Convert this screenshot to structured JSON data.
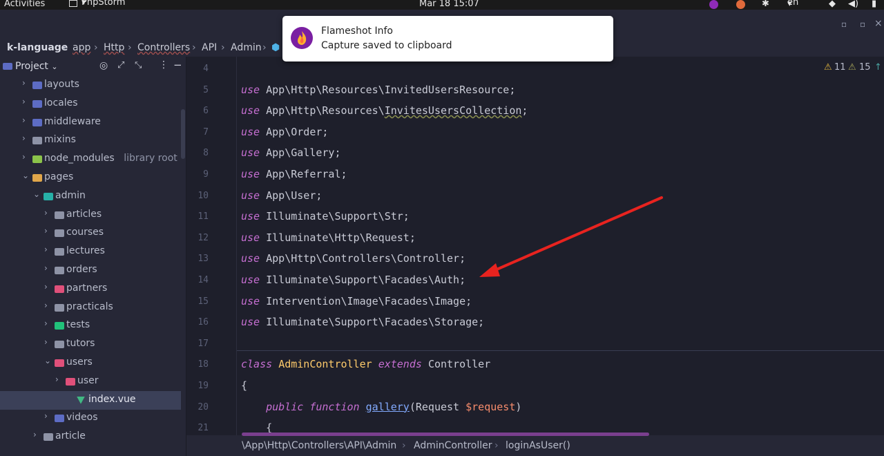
{
  "topbar": {
    "activities": "Activities",
    "app_name": "PhpStorm",
    "app_menu_icon": "triangle-down",
    "clock": "Mar 18  15:07",
    "lang": "en",
    "tray_icons": [
      "flameshot-icon",
      "chrome-icon",
      "slack-icon",
      "wifi-icon",
      "volume-icon",
      "battery-icon"
    ]
  },
  "window_controls": [
    "minimize",
    "maximize",
    "close"
  ],
  "breadcrumb": {
    "items": [
      "k-language",
      "app",
      "Http",
      "Controllers",
      "API",
      "Admin"
    ],
    "separator": "›"
  },
  "project_panel": {
    "title": "Project",
    "toolbar_icons": [
      "target-icon",
      "expand-icon",
      "collapse-icon",
      "more-icon",
      "hide-icon"
    ]
  },
  "tree": [
    {
      "label": "layouts",
      "extra": "",
      "depth": 0,
      "expanded": false,
      "icon_color": "#5d6cc4"
    },
    {
      "label": "locales",
      "extra": "",
      "depth": 0,
      "expanded": false,
      "icon_color": "#5d6cc4"
    },
    {
      "label": "middleware",
      "extra": "",
      "depth": 0,
      "expanded": false,
      "icon_color": "#5d6cc4"
    },
    {
      "label": "mixins",
      "extra": "",
      "depth": 0,
      "expanded": false,
      "icon_color": "#8e93a6"
    },
    {
      "label": "node_modules",
      "extra": "library root",
      "depth": 0,
      "expanded": false,
      "icon_color": "#8bc34a"
    },
    {
      "label": "pages",
      "extra": "",
      "depth": 0,
      "expanded": true,
      "icon_color": "#e0a64a"
    },
    {
      "label": "admin",
      "extra": "",
      "depth": 1,
      "expanded": true,
      "icon_color": "#27b1a8"
    },
    {
      "label": "articles",
      "extra": "",
      "depth": 2,
      "expanded": false,
      "icon_color": "#8e93a6"
    },
    {
      "label": "courses",
      "extra": "",
      "depth": 2,
      "expanded": false,
      "icon_color": "#8e93a6"
    },
    {
      "label": "lectures",
      "extra": "",
      "depth": 2,
      "expanded": false,
      "icon_color": "#8e93a6"
    },
    {
      "label": "orders",
      "extra": "",
      "depth": 2,
      "expanded": false,
      "icon_color": "#8e93a6"
    },
    {
      "label": "partners",
      "extra": "",
      "depth": 2,
      "expanded": false,
      "icon_color": "#e0507a"
    },
    {
      "label": "practicals",
      "extra": "",
      "depth": 2,
      "expanded": false,
      "icon_color": "#8e93a6"
    },
    {
      "label": "tests",
      "extra": "",
      "depth": 2,
      "expanded": false,
      "icon_color": "#21c17a"
    },
    {
      "label": "tutors",
      "extra": "",
      "depth": 2,
      "expanded": false,
      "icon_color": "#8e93a6"
    },
    {
      "label": "users",
      "extra": "",
      "depth": 2,
      "expanded": true,
      "icon_color": "#e0507a"
    },
    {
      "label": "user",
      "extra": "",
      "depth": 3,
      "expanded": false,
      "icon_color": "#e0507a"
    },
    {
      "label": "index.vue",
      "extra": "",
      "depth": 4,
      "expanded": null,
      "icon_color": "#41b883",
      "selected": true
    },
    {
      "label": "videos",
      "extra": "",
      "depth": 2,
      "expanded": false,
      "icon_color": "#5d6cc4"
    },
    {
      "label": "article",
      "extra": "",
      "depth": 1,
      "expanded": false,
      "icon_color": "#8e93a6"
    }
  ],
  "editor": {
    "inspections": {
      "warnings": "11",
      "weak_warnings": "15"
    },
    "line_numbers": [
      "4",
      "5",
      "6",
      "7",
      "8",
      "9",
      "10",
      "11",
      "12",
      "13",
      "14",
      "15",
      "16",
      "17",
      "18",
      "19",
      "20",
      "21"
    ],
    "lines": [
      {
        "type": "blank"
      },
      {
        "type": "use",
        "path": "App\\Http\\Resources\\InvitedUsersResource;"
      },
      {
        "type": "use_underlined",
        "prefix": "App\\Http\\Resources\\",
        "underlined": "InvitesUsersCollection",
        "suffix": ";"
      },
      {
        "type": "use",
        "path": "App\\Order;"
      },
      {
        "type": "use",
        "path": "App\\Gallery;"
      },
      {
        "type": "use",
        "path": "App\\Referral;"
      },
      {
        "type": "use",
        "path": "App\\User;"
      },
      {
        "type": "use",
        "path": "Illuminate\\Support\\Str;"
      },
      {
        "type": "use",
        "path": "Illuminate\\Http\\Request;"
      },
      {
        "type": "use",
        "path": "App\\Http\\Controllers\\Controller;"
      },
      {
        "type": "use",
        "path": "Illuminate\\Support\\Facades\\Auth;"
      },
      {
        "type": "use",
        "path": "Intervention\\Image\\Facades\\Image;"
      },
      {
        "type": "use",
        "path": "Illuminate\\Support\\Facades\\Storage;"
      },
      {
        "type": "blank"
      },
      {
        "type": "class",
        "kw": "class",
        "name": "AdminController",
        "ext": "extends",
        "parent": "Controller"
      },
      {
        "type": "text",
        "text": "{"
      },
      {
        "type": "method",
        "mod": "public",
        "fkw": "function",
        "name": "gallery",
        "arg_type": "Request",
        "arg": "$request"
      },
      {
        "type": "text",
        "text": "    {"
      }
    ],
    "use_keyword": "use"
  },
  "statusbar": {
    "namespace": "\\App\\Http\\Controllers\\API\\Admin",
    "class": "AdminController",
    "method": "loginAsUser()"
  },
  "notification": {
    "title": "Flameshot Info",
    "message": "Capture saved to clipboard"
  },
  "colors": {
    "annotation_arrow": "#e8231f",
    "keyword": "#c66fd2",
    "class_name": "#ffcb6b",
    "function_name": "#82aaff",
    "variable": "#f78c6c"
  }
}
